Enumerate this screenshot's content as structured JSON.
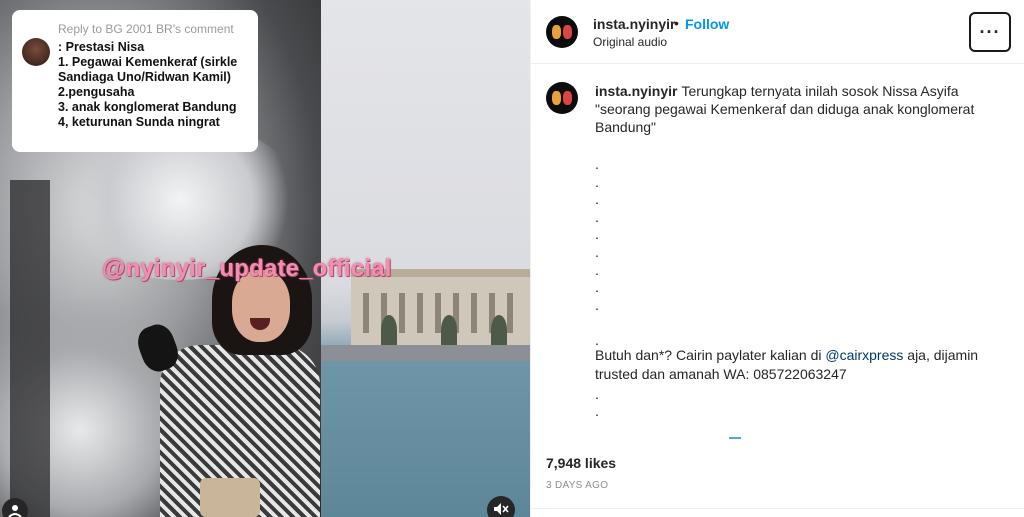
{
  "reply_bubble": {
    "header": "Reply to BG 2001 BR's comment",
    "lines": [
      ": Prestasi Nisa",
      "1. Pegawai Kemenkeraf (sirkle",
      "Sandiaga Uno/Ridwan Kamil)",
      "2.pengusaha",
      "3. anak konglomerat Bandung",
      "4, keturunan Sunda ningrat"
    ]
  },
  "watermark": "@nyinyir_update_official",
  "header": {
    "username": "insta.nyinyir",
    "separator": "•",
    "follow_label": "Follow",
    "audio": "Original audio",
    "more_label": "···"
  },
  "caption": {
    "username": "insta.nyinyir",
    "text": "Terungkap ternyata inilah sosok Nissa Asyifa \"seorang pegawai Kemenkeraf dan diduga anak konglomerat Bandung\"",
    "dots": [
      ".",
      ".",
      ".",
      ".",
      ".",
      ".",
      ".",
      ".",
      ".",
      "",
      "."
    ],
    "promo_before": "Butuh dan*? Cairin paylater kalian di ",
    "promo_mention": "@cairxpress",
    "promo_after": " aja, dijamin trusted dan amanah WA: 085722063247",
    "trailing_dots": [
      ".",
      "."
    ]
  },
  "likes": "7,948 likes",
  "time": "3 DAYS AGO",
  "icons": {
    "mute": "mute-icon",
    "tag": "user-tag-icon",
    "more": "more-options-icon"
  }
}
